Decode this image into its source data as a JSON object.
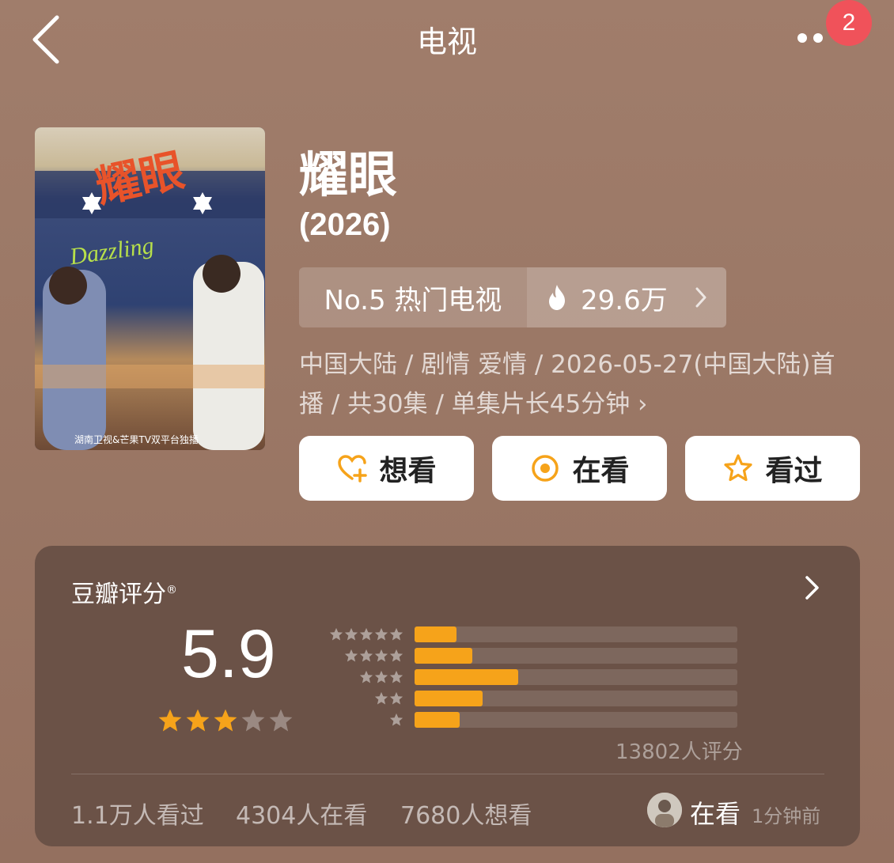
{
  "nav": {
    "title": "电视",
    "badge_count": "2"
  },
  "movie": {
    "title": "耀眼",
    "year": "(2026)",
    "rank": "No.5 热门电视",
    "heat": "29.6万",
    "meta_line1": "中国大陆 / 剧情 爱情 / 2026-05-27(中国大陆)首",
    "meta_line2": "播 / 共30集 / 单集片长45分钟 ›"
  },
  "poster": {
    "title_text": "耀眼",
    "subtitle": "Dazzling",
    "caption": "湖南卫视&芒果TV双平台独播"
  },
  "actions": [
    {
      "label": "想看",
      "icon": "heart-plus-icon"
    },
    {
      "label": "在看",
      "icon": "target-icon"
    },
    {
      "label": "看过",
      "icon": "star-outline-icon"
    }
  ],
  "rating": {
    "label": "豆瓣评分",
    "registered_mark": "®",
    "score": "5.9",
    "stars_filled": 3,
    "stars_total": 5,
    "distribution": [
      {
        "stars": 5,
        "percent": 13
      },
      {
        "stars": 4,
        "percent": 18
      },
      {
        "stars": 3,
        "percent": 32
      },
      {
        "stars": 2,
        "percent": 21
      },
      {
        "stars": 1,
        "percent": 14
      }
    ],
    "count": "13802人评分",
    "watched": "1.1万人看过",
    "watching": "4304人在看",
    "want": "7680人想看",
    "friend_status": "在看",
    "friend_time": "1分钟前"
  },
  "colors": {
    "accent": "#f6a31a",
    "badge": "#f0525a",
    "card": "#6b5247"
  }
}
